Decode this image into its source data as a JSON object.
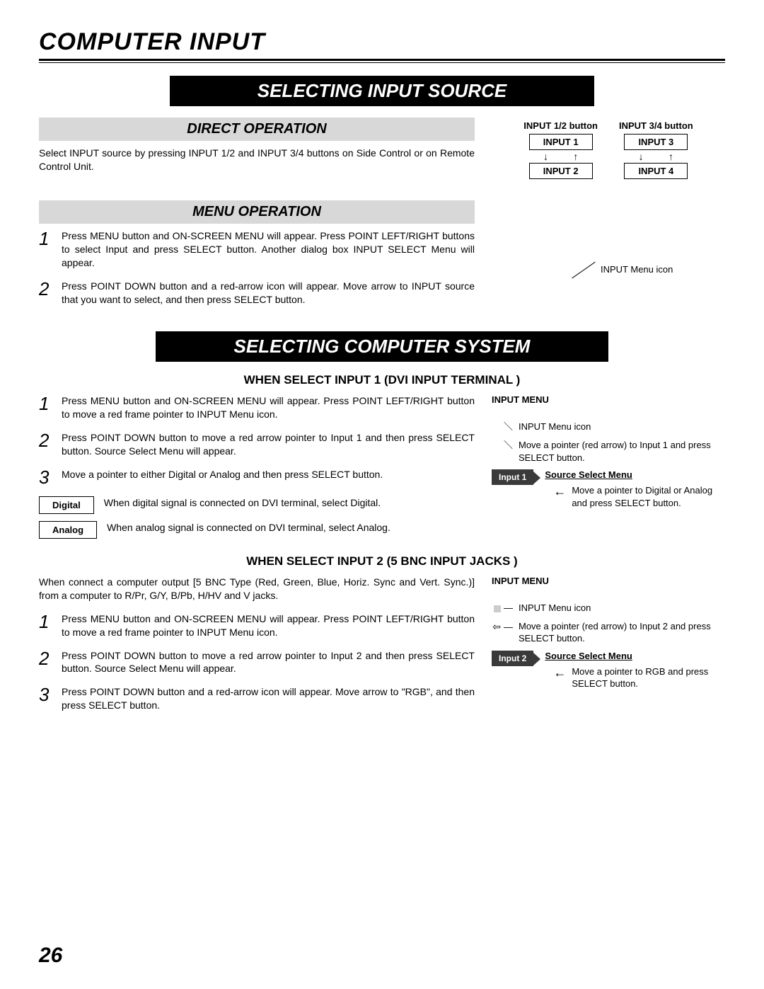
{
  "page_title": "COMPUTER INPUT",
  "page_number": "26",
  "section1": {
    "bar": "SELECTING INPUT SOURCE",
    "direct_heading": "DIRECT OPERATION",
    "direct_text": "Select INPUT source by pressing INPUT 1/2 and INPUT 3/4 buttons on Side Control or on Remote Control Unit.",
    "inp12_label": "INPUT 1/2 button",
    "inp34_label": "INPUT 3/4 button",
    "inp1": "INPUT 1",
    "inp2": "INPUT 2",
    "inp3": "INPUT 3",
    "inp4": "INPUT 4",
    "menu_heading": "MENU OPERATION",
    "step1": "Press MENU button and ON-SCREEN MENU will appear.  Press POINT LEFT/RIGHT buttons to select Input and press  SELECT button.  Another dialog box INPUT SELECT Menu will appear.",
    "step2": "Press POINT DOWN button and a red-arrow icon will appear. Move arrow to INPUT source that you want to select, and then press SELECT button.",
    "menu_icon_note": "INPUT Menu icon"
  },
  "section2": {
    "bar": "SELECTING COMPUTER SYSTEM",
    "sub1_heading": "WHEN SELECT  INPUT 1 (DVI INPUT TERMINAL )",
    "s1_step1": "Press MENU button and ON-SCREEN MENU will appear.  Press POINT LEFT/RIGHT button to move a red frame pointer to INPUT Menu icon.",
    "s1_step2": "Press POINT DOWN button to move a red arrow pointer to Input 1 and then press SELECT button.  Source Select Menu will appear.",
    "s1_step3": "Move a pointer to either Digital or Analog and then press SELECT button.",
    "digital_label": "Digital",
    "analog_label": "Analog",
    "digital_text": "When digital signal is connected on DVI terminal, select Digital.",
    "analog_text": "When analog signal is connected on DVI terminal, select Analog.",
    "input_menu_label": "INPUT MENU",
    "r1_note1": "INPUT Menu icon",
    "r1_note2": "Move a pointer (red arrow) to Input 1 and press SELECT button.",
    "r1_badge": "Input 1",
    "r1_source_title": "Source Select Menu",
    "r1_note3": "Move a pointer to Digital or Analog and press SELECT button.",
    "sub2_heading": "WHEN SELECT INPUT 2 (5 BNC INPUT JACKS )",
    "s2_intro": "When connect a computer output [5 BNC Type (Red, Green, Blue, Horiz. Sync and Vert. Sync.)] from a computer to R/Pr, G/Y, B/Pb, H/HV and V jacks.",
    "s2_step1": "Press MENU button and ON-SCREEN MENU will appear.  Press POINT LEFT/RIGHT button to move a red frame pointer to INPUT Menu icon.",
    "s2_step2": "Press POINT DOWN button to move a red arrow pointer to Input 2 and then press SELECT button.  Source Select Menu will appear.",
    "s2_step3": "Press POINT DOWN button and a red-arrow icon will appear. Move arrow to \"RGB\", and then press SELECT button.",
    "r2_note1": "INPUT Menu icon",
    "r2_note2": "Move a pointer (red arrow) to Input 2 and press SELECT button.",
    "r2_badge": "Input 2",
    "r2_source_title": "Source Select Menu",
    "r2_note3": "Move a pointer to RGB and press SELECT button."
  }
}
